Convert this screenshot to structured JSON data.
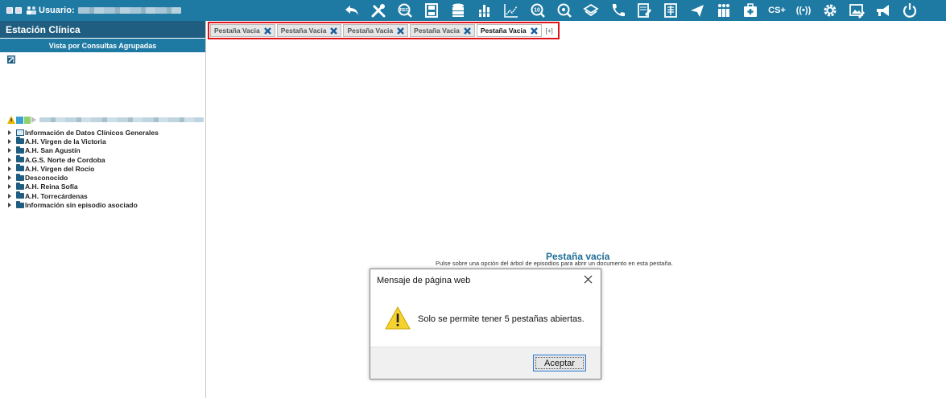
{
  "topbar": {
    "user_label": "Usuario:",
    "tools": [
      {
        "name": "back-icon"
      },
      {
        "name": "tools-icon"
      },
      {
        "name": "rec-icon",
        "text": "REC"
      },
      {
        "name": "save-icon"
      },
      {
        "name": "database-icon"
      },
      {
        "name": "bar-chart-icon"
      },
      {
        "name": "trend-chart-icon"
      },
      {
        "name": "ten-icon",
        "text": "10"
      },
      {
        "name": "search-zoom-icon"
      },
      {
        "name": "layers-icon"
      },
      {
        "name": "phone-icon"
      },
      {
        "name": "document-edit-icon"
      },
      {
        "name": "xray-icon"
      },
      {
        "name": "send-icon"
      },
      {
        "name": "family-icon"
      },
      {
        "name": "medkit-icon"
      },
      {
        "name": "cs-plus-icon",
        "text": "CS+"
      },
      {
        "name": "broadcast-icon",
        "text": "((•))"
      },
      {
        "name": "settings-gear-icon"
      },
      {
        "name": "image-edit-icon"
      },
      {
        "name": "megaphone-icon"
      },
      {
        "name": "power-icon"
      }
    ]
  },
  "sidebar": {
    "title": "Estación Clínica",
    "subtitle": "Vista por Consultas Agrupadas",
    "tree": [
      {
        "label": "Información de Datos Clínicos Generales",
        "icon": "document-icon"
      },
      {
        "label": "A.H. Virgen de la Victoria",
        "icon": "folder-icon"
      },
      {
        "label": "A.H. San Agustín",
        "icon": "folder-icon"
      },
      {
        "label": "A.G.S. Norte de Cordoba",
        "icon": "folder-icon"
      },
      {
        "label": "A.H. Virgen del Rocío",
        "icon": "folder-icon"
      },
      {
        "label": "Desconocido",
        "icon": "folder-icon"
      },
      {
        "label": "A.H. Reina Sofía",
        "icon": "folder-icon"
      },
      {
        "label": "A.H. Torrecárdenas",
        "icon": "folder-icon"
      },
      {
        "label": "Información sin episodio asociado",
        "icon": "folder-icon"
      }
    ]
  },
  "tabs": {
    "items": [
      {
        "label": "Pestaña Vacia",
        "active": false
      },
      {
        "label": "Pestaña Vacia",
        "active": false
      },
      {
        "label": "Pestaña Vacia",
        "active": false
      },
      {
        "label": "Pestaña Vacia",
        "active": false
      },
      {
        "label": "Pestaña Vacia",
        "active": true
      }
    ],
    "add_label": "[+]",
    "highlight_color": "#e0131b"
  },
  "content": {
    "title": "Pestaña vacía",
    "description": "Pulse sobre una opción del árbol de episodios para abrir un documento en esta pestaña."
  },
  "dialog": {
    "title": "Mensaje de página web",
    "message": "Solo se permite tener 5 pestañas abiertas.",
    "ok_label": "Aceptar"
  },
  "colors": {
    "topbar": "#1f7aa3",
    "sidebar_title": "#1f5e80",
    "accent": "#1f6f98",
    "tab_close": "#1a5f9e"
  }
}
